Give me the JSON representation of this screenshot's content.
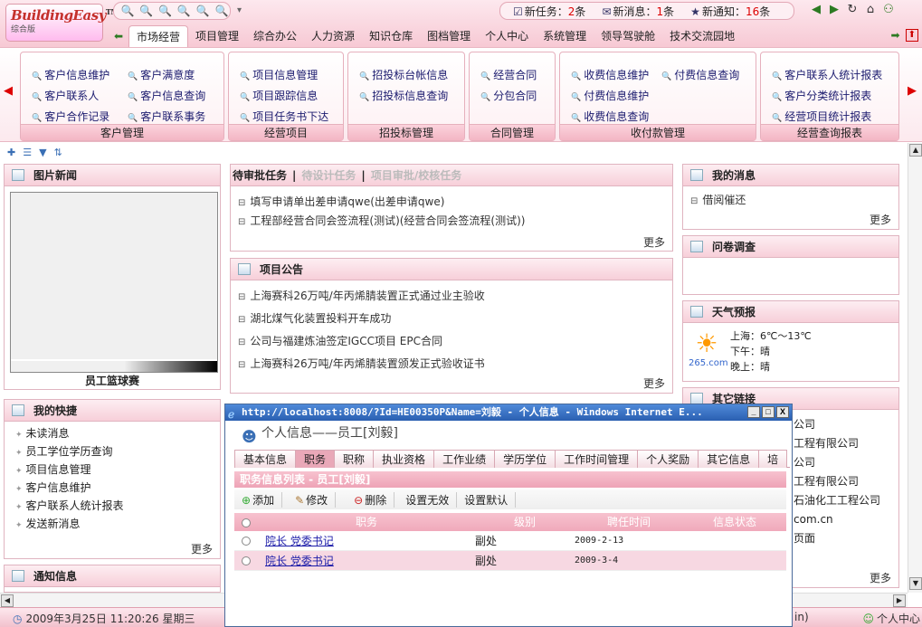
{
  "app": {
    "logo_text": "BuildingEasy",
    "logo_tm": "TM",
    "logo_sub": "综合版"
  },
  "toolbar": {
    "icons": [
      "magnifier-icon",
      "magnifier-icon",
      "magnifier-icon",
      "magnifier-icon",
      "magnifier-icon",
      "magnifier-icon"
    ],
    "dropdown": "▾"
  },
  "stats": {
    "task_label": "新任务：",
    "task_count": "2",
    "task_unit": "条",
    "msg_label": "新消息：",
    "msg_count": "1",
    "msg_unit": "条",
    "notice_label": "新通知：",
    "notice_count": "16",
    "notice_unit": "条"
  },
  "menu": {
    "items": [
      "市场经营",
      "项目管理",
      "综合办公",
      "人力资源",
      "知识仓库",
      "图档管理",
      "个人中心",
      "系统管理",
      "领导驾驶舱",
      "技术交流园地"
    ],
    "selected": "市场经营"
  },
  "ribbon": {
    "groups": [
      {
        "label": "客户管理",
        "items": [
          "客户信息维护",
          "客户满意度",
          "客户联系人",
          "客户信息查询",
          "客户合作记录",
          "客户联系事务"
        ]
      },
      {
        "label": "经营项目",
        "items": [
          "项目信息管理",
          "项目跟踪信息",
          "项目任务书下达"
        ]
      },
      {
        "label": "招投标管理",
        "items": [
          "招投标台帐信息",
          "招投标信息查询"
        ]
      },
      {
        "label": "合同管理",
        "items": [
          "经营合同",
          "分包合同"
        ]
      },
      {
        "label": "收付款管理",
        "items": [
          "收费信息维护",
          "付费信息查询",
          "付费信息维护",
          "收费信息查询"
        ]
      },
      {
        "label": "经营查询报表",
        "items": [
          "客户联系人统计报表",
          "客户分类统计报表",
          "经营项目统计报表"
        ]
      }
    ]
  },
  "panels": {
    "photo_news": {
      "title": "图片新闻",
      "caption": "员工篮球赛"
    },
    "pending": {
      "tab1": "待审批任务",
      "sep": "|",
      "tab2": "待设计任务",
      "tab3": "项目审批/校核任务",
      "items": [
        "填写申请单出差申请qwe(出差申请qwe)",
        "工程部经营合同会签流程(测试)(经营合同会签流程(测试))"
      ],
      "more": "更多"
    },
    "announce": {
      "title": "项目公告",
      "items": [
        "上海赛科26万吨/年丙烯腈装置正式通过业主验收",
        "湖北煤气化装置投料开车成功",
        "公司与福建炼油签定IGCC项目 EPC合同",
        "上海赛科26万吨/年丙烯腈装置颁发正式验收证书"
      ],
      "more": "更多"
    },
    "my_msg": {
      "title": "我的消息",
      "items": [
        "借阅催还"
      ],
      "more": "更多"
    },
    "survey": {
      "title": "问卷调查"
    },
    "weather": {
      "title": "天气预报",
      "city": "上海：6℃～13℃",
      "afternoon": "下午：晴",
      "evening": "晚上：晴",
      "brand": "265.com"
    },
    "links": {
      "title": "其它链接",
      "items": [
        "公司",
        "工程有限公司",
        "公司",
        "工程有限公司",
        "石油化工工程公司",
        "com.cn",
        "页面"
      ],
      "more": "更多"
    },
    "quick": {
      "title": "我的快捷",
      "items": [
        "未读消息",
        "员工学位学历查询",
        "项目信息管理",
        "客户信息维护",
        "客户联系人统计报表",
        "发送新消息"
      ],
      "more": "更多"
    },
    "notice": {
      "title": "通知信息"
    }
  },
  "popup": {
    "title": "http://localhost:8008/?Id=HE00350P&Name=刘毅 - 个人信息 - Windows Internet E...",
    "ctl_min": "_",
    "ctl_max": "□",
    "ctl_close": "X",
    "heading": "个人信息——员工[刘毅]",
    "tabs": [
      "基本信息",
      "职务",
      "职称",
      "执业资格",
      "工作业绩",
      "学历学位",
      "工作时间管理",
      "个人奖励",
      "其它信息",
      "培"
    ],
    "selected_tab": "职务",
    "list_header": "职务信息列表 - 员工[刘毅]",
    "actions": {
      "add": "添加",
      "edit": "修改",
      "delete": "删除",
      "invalid": "设置无效",
      "default": "设置默认"
    },
    "columns": [
      "职务",
      "级别",
      "聘任时间",
      "信息状态"
    ],
    "rows": [
      {
        "title": "院长 党委书记",
        "level": "副处",
        "date": "2009-2-13",
        "status": ""
      },
      {
        "title": "院长 党委书记",
        "level": "副处",
        "date": "2009-3-4",
        "status": ""
      }
    ]
  },
  "statusbar": {
    "datetime": "2009年3月25日 11:20:26 星期三",
    "fragment": "in)",
    "personal": "个人中心"
  }
}
